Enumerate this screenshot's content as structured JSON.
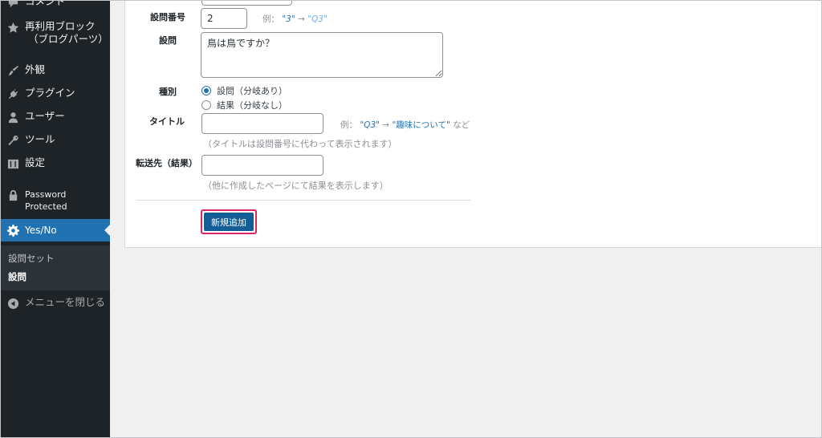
{
  "sidebar": {
    "items": [
      {
        "label": "コメント",
        "icon": "comment-icon"
      },
      {
        "label": "再利用ブロック\n（ブログパーツ）",
        "line1": "再利用ブロック",
        "line2": "（ブログパーツ）",
        "icon": "star-icon"
      },
      {
        "label": "外観",
        "icon": "paintbrush-icon"
      },
      {
        "label": "プラグイン",
        "icon": "plugin-icon"
      },
      {
        "label": "ユーザー",
        "icon": "user-icon"
      },
      {
        "label": "ツール",
        "icon": "wrench-icon"
      },
      {
        "label": "設定",
        "icon": "settings-icon"
      },
      {
        "label": "Password Protected",
        "line1": "Password",
        "line2": "Protected",
        "icon": "lock-icon"
      },
      {
        "label": "Yes/No",
        "icon": "gear-icon",
        "active": true
      }
    ],
    "submenu": [
      {
        "label": "設問セット"
      },
      {
        "label": "設問",
        "current": true
      }
    ],
    "collapse_label": "メニューを閉じる"
  },
  "form": {
    "number": {
      "label": "設問番号",
      "value": "2",
      "hint_prefix": "例：",
      "hint_from": "\"3\"",
      "hint_arrow": "→",
      "hint_to": "\"Q3\""
    },
    "question": {
      "label": "設問",
      "value": "鳥は鳥ですか？"
    },
    "type": {
      "label": "種別",
      "options": [
        {
          "label": "設問（分岐あり）",
          "checked": true
        },
        {
          "label": "結果（分岐なし）",
          "checked": false
        }
      ]
    },
    "title": {
      "label": "タイトル",
      "value": "",
      "hint_prefix": "例：",
      "hint_from": "\"Q3\"",
      "hint_arrow": "→",
      "hint_to": "\"趣味について\"",
      "hint_suffix": "など",
      "note": "（タイトルは設問番号に代わって表示されます）"
    },
    "redirect": {
      "label": "転送先（結果）",
      "value": "",
      "note": "（他に作成したページにて結果を表示します）"
    },
    "submit_label": "新規追加"
  },
  "colors": {
    "sidebar_bg": "#1d2327",
    "active_bg": "#2271b1",
    "button_bg": "#135e96",
    "highlight_border": "#e0245e"
  }
}
